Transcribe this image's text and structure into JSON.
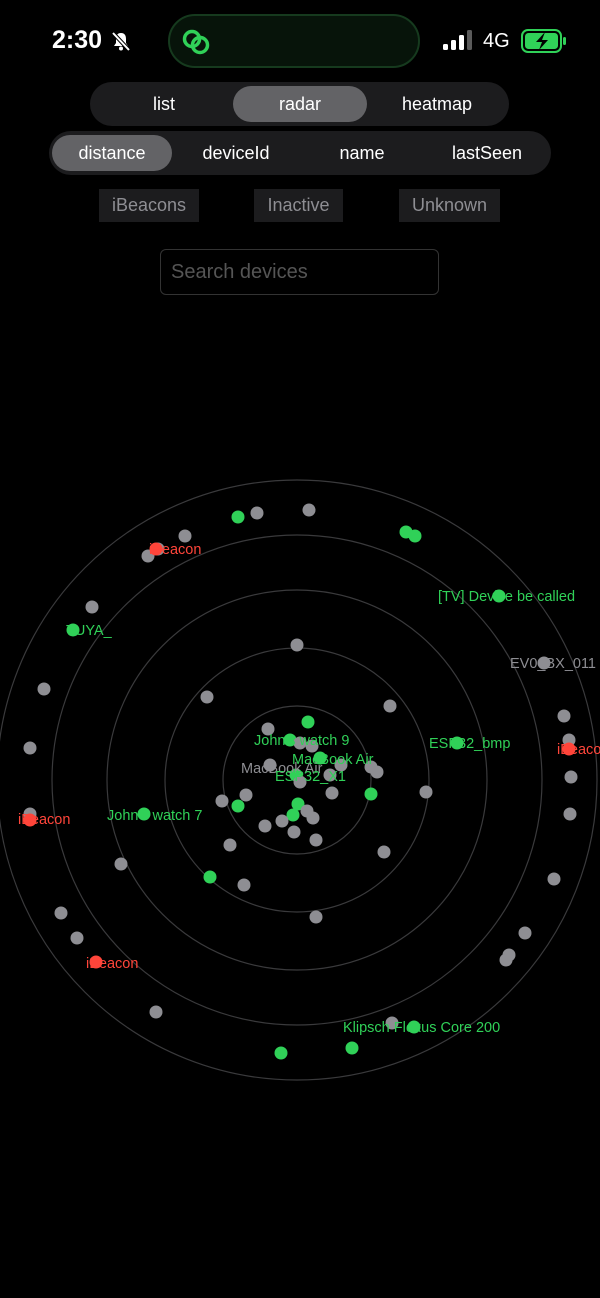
{
  "status_bar": {
    "time": "2:30",
    "network": "4G"
  },
  "view_tabs": [
    "list",
    "radar",
    "heatmap"
  ],
  "active_view": "radar",
  "sort_tabs": [
    "distance",
    "deviceId",
    "name",
    "lastSeen"
  ],
  "active_sort": "distance",
  "filters": [
    "iBeacons",
    "Inactive",
    "Unknown"
  ],
  "search": {
    "placeholder": "Search devices",
    "value": ""
  },
  "colors": {
    "active": "#30d158",
    "inactive": "#8e8e93",
    "ibeacon": "#ff453a",
    "ring": "#3a3a3c"
  },
  "radar": {
    "labels": [
      {
        "text": "iBeacon",
        "status": "ibeacon"
      },
      {
        "text": "TUYA_",
        "status": "active"
      },
      {
        "text": "[TV] Device be called",
        "status": "active"
      },
      {
        "text": "EV0_BX_011",
        "status": "inactive"
      },
      {
        "text": "iBeacon",
        "status": "ibeacon"
      },
      {
        "text": "John's watch 9",
        "status": "active"
      },
      {
        "text": "MacBook Air",
        "status": "active"
      },
      {
        "text": "MacBook Air",
        "status": "inactive"
      },
      {
        "text": "ESP32_bmp",
        "status": "active"
      },
      {
        "text": "ESP32_X1",
        "status": "active"
      },
      {
        "text": "John's watch 7",
        "status": "active"
      },
      {
        "text": "iBeacon",
        "status": "ibeacon"
      },
      {
        "text": "iBeacon",
        "status": "ibeacon"
      },
      {
        "text": "Klipsch Flexus Core 200",
        "status": "active"
      }
    ]
  }
}
